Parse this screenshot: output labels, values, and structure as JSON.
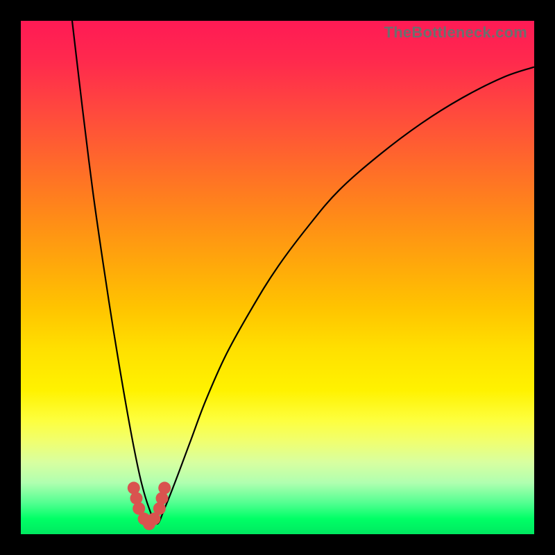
{
  "watermark": "TheBottleneck.com",
  "chart_data": {
    "type": "line",
    "title": "",
    "xlabel": "",
    "ylabel": "",
    "xlim": [
      0,
      100
    ],
    "ylim": [
      0,
      100
    ],
    "grid": false,
    "legend": false,
    "series": [
      {
        "name": "curve",
        "x": [
          10,
          12,
          14,
          16,
          18,
          20,
          22,
          23.5,
          25,
          26.5,
          28,
          30,
          33,
          36,
          40,
          45,
          50,
          56,
          62,
          70,
          78,
          86,
          94,
          100
        ],
        "values": [
          100,
          83,
          67,
          53,
          40,
          28,
          17,
          10,
          5,
          2,
          5,
          10,
          18,
          26,
          35,
          44,
          52,
          60,
          67,
          74,
          80,
          85,
          89,
          91
        ]
      }
    ],
    "markers": {
      "name": "highlight-points",
      "x": [
        22.0,
        22.5,
        23.0,
        24.0,
        25.0,
        26.0,
        27.0,
        27.5,
        28.0
      ],
      "values": [
        9,
        7,
        5,
        3,
        2,
        3,
        5,
        7,
        9
      ]
    },
    "background_gradient": {
      "direction": "vertical",
      "stops": [
        {
          "pos": 0.0,
          "color": "#ff1a55"
        },
        {
          "pos": 0.5,
          "color": "#ffc400"
        },
        {
          "pos": 0.8,
          "color": "#fdff40"
        },
        {
          "pos": 1.0,
          "color": "#00e860"
        }
      ]
    }
  }
}
